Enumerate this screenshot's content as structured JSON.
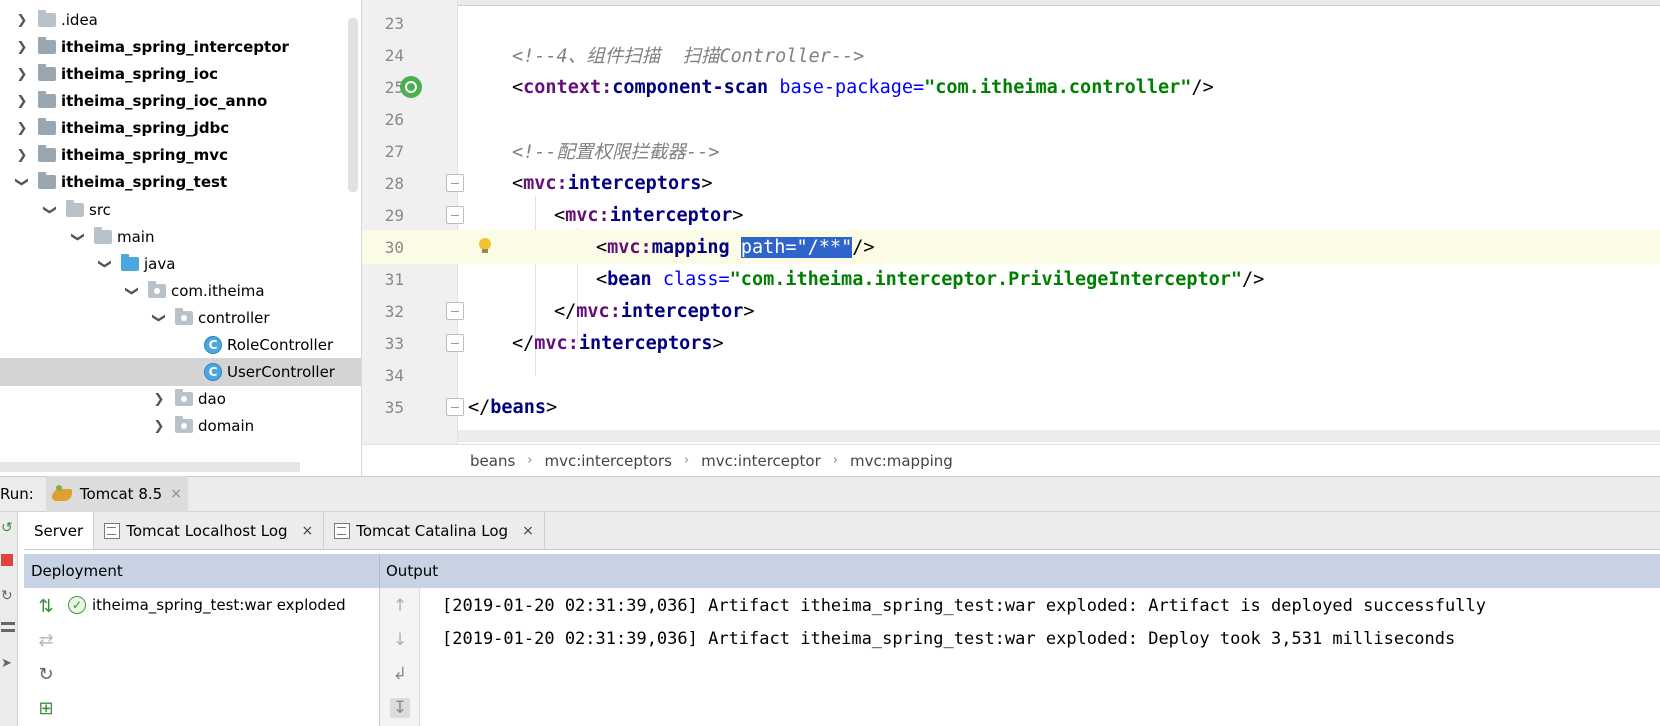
{
  "project_tree": {
    "items": [
      {
        "label": ".idea",
        "bold": false
      },
      {
        "label": "itheima_spring_interceptor",
        "bold": true
      },
      {
        "label": "itheima_spring_ioc",
        "bold": true
      },
      {
        "label": "itheima_spring_ioc_anno",
        "bold": true
      },
      {
        "label": "itheima_spring_jdbc",
        "bold": true
      },
      {
        "label": "itheima_spring_mvc",
        "bold": true
      },
      {
        "label": "itheima_spring_test",
        "bold": true
      },
      {
        "label": "src"
      },
      {
        "label": "main"
      },
      {
        "label": "java"
      },
      {
        "label": "com.itheima"
      },
      {
        "label": "controller"
      },
      {
        "label": "RoleController"
      },
      {
        "label": "UserController"
      },
      {
        "label": "dao"
      },
      {
        "label": "domain"
      }
    ],
    "class_icon_letter": "C",
    "selected": "UserController"
  },
  "editor": {
    "line_numbers": [
      "23",
      "24",
      "25",
      "26",
      "27",
      "28",
      "29",
      "30",
      "31",
      "32",
      "33",
      "34",
      "35"
    ],
    "current_line": "30",
    "code": {
      "l24_comment": "<!--4、组件扫描  扫描Controller-->",
      "l25_open": "<",
      "l25_ns": "context:",
      "l25_tag": "component-scan",
      "l25_attr": " base-package=",
      "l25_val": "\"com.itheima.controller\"",
      "l25_close": "/>",
      "l27_comment": "<!--配置权限拦截器-->",
      "l28_open": "<",
      "l28_ns": "mvc:",
      "l28_tag": "interceptors",
      "l28_close": ">",
      "l29_open": "<",
      "l29_ns": "mvc:",
      "l29_tag": "interceptor",
      "l29_close": ">",
      "l30_open": "<",
      "l30_ns": "mvc:",
      "l30_tag": "mapping",
      "l30_space": " ",
      "l30_sel_attr": "path=",
      "l30_sel_val": "\"/**\"",
      "l30_close": "/>",
      "l31_open": "<",
      "l31_tag": "bean",
      "l31_attr": " class=",
      "l31_val": "\"com.itheima.interceptor.PrivilegeInterceptor\"",
      "l31_close": "/>",
      "l32_open": "</",
      "l32_ns": "mvc:",
      "l32_tag": "interceptor",
      "l32_close": ">",
      "l33_open": "</",
      "l33_ns": "mvc:",
      "l33_tag": "interceptors",
      "l33_close": ">",
      "l35_open": "</",
      "l35_tag": "beans",
      "l35_close": ">"
    },
    "breadcrumbs": [
      "beans",
      "mvc:interceptors",
      "mvc:interceptor",
      "mvc:mapping"
    ],
    "breadcrumb_sep": "›"
  },
  "run": {
    "label": "Run:",
    "config_name": "Tomcat 8.5",
    "close_glyph": "×",
    "tabs": [
      {
        "label": "Server",
        "active": true
      },
      {
        "label": "Tomcat Localhost Log"
      },
      {
        "label": "Tomcat Catalina Log"
      }
    ],
    "deployment_header": "Deployment",
    "output_header": "Output",
    "deployment_item": "itheima_spring_test:war exploded",
    "output_lines": [
      "[2019-01-20 02:31:39,036] Artifact itheima_spring_test:war exploded: Artifact is deployed successfully",
      "[2019-01-20 02:31:39,036] Artifact itheima_spring_test:war exploded: Deploy took 3,531 milliseconds"
    ]
  },
  "colors": {
    "selection": "#2f65ca",
    "current_line": "#fcfbe5",
    "header_bar": "#c7d3e3",
    "xml_tag": "#000080",
    "xml_value": "#008000",
    "comment": "#808080"
  },
  "icons": [
    "chevron-right-icon",
    "chevron-down-icon",
    "folder-icon",
    "class-icon",
    "tomcat-icon",
    "close-icon",
    "log-icon",
    "check-icon",
    "lightbulb-icon",
    "spring-bean-icon",
    "arrow-up-icon",
    "arrow-down-icon",
    "wrap-icon",
    "scroll-end-icon",
    "deploy-icon",
    "refresh-icon",
    "stop-icon",
    "pin-icon",
    "rerun-icon"
  ]
}
